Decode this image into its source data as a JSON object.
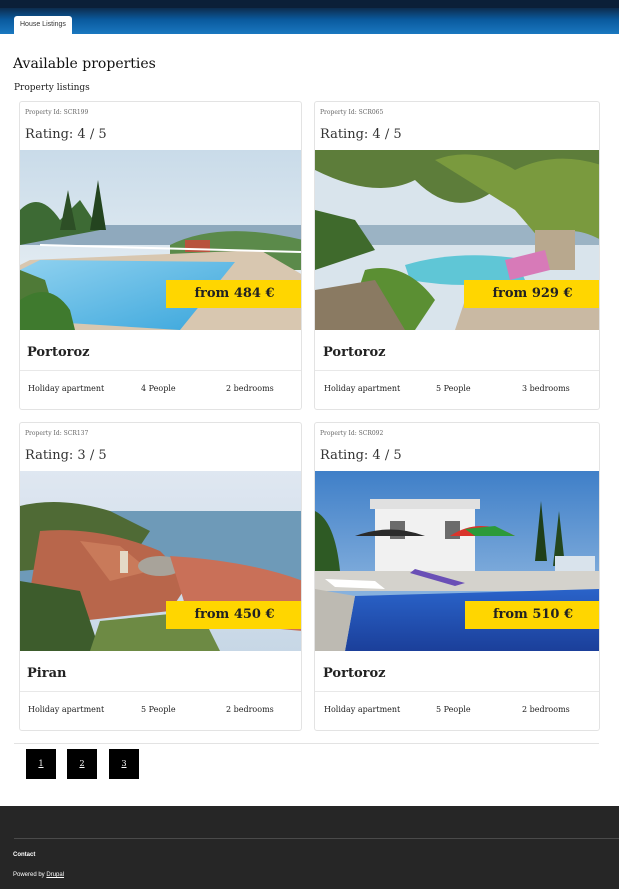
{
  "header": {
    "tab_label": "House Listings"
  },
  "page": {
    "title": "Available properties",
    "subtitle": "Property listings"
  },
  "listings": [
    {
      "property_id": "Property Id: SCR199",
      "rating": "Rating: 4 / 5",
      "price": "from 484 €",
      "city": "Portoroz",
      "type": "Holiday apartment",
      "people": "4 People",
      "bedrooms": "2 bedrooms"
    },
    {
      "property_id": "Property Id: SCR065",
      "rating": "Rating: 4 / 5",
      "price": "from 929 €",
      "city": "Portoroz",
      "type": "Holiday apartment",
      "people": "5 People",
      "bedrooms": "3 bedrooms"
    },
    {
      "property_id": "Property Id: SCR137",
      "rating": "Rating: 3 / 5",
      "price": "from 450 €",
      "city": "Piran",
      "type": "Holiday apartment",
      "people": "5 People",
      "bedrooms": "2 bedrooms"
    },
    {
      "property_id": "Property Id: SCR092",
      "rating": "Rating: 4 / 5",
      "price": "from 510 €",
      "city": "Portoroz",
      "type": "Holiday apartment",
      "people": "5 People",
      "bedrooms": "2 bedrooms"
    }
  ],
  "pagination": {
    "pages": [
      "1",
      "2",
      "3"
    ]
  },
  "footer": {
    "contact": "Contact",
    "powered_prefix": "Powered by",
    "powered_link": "Drupal"
  },
  "colors": {
    "price_badge": "#ffd600",
    "header": "#0a5a9e",
    "footer": "#262626"
  }
}
